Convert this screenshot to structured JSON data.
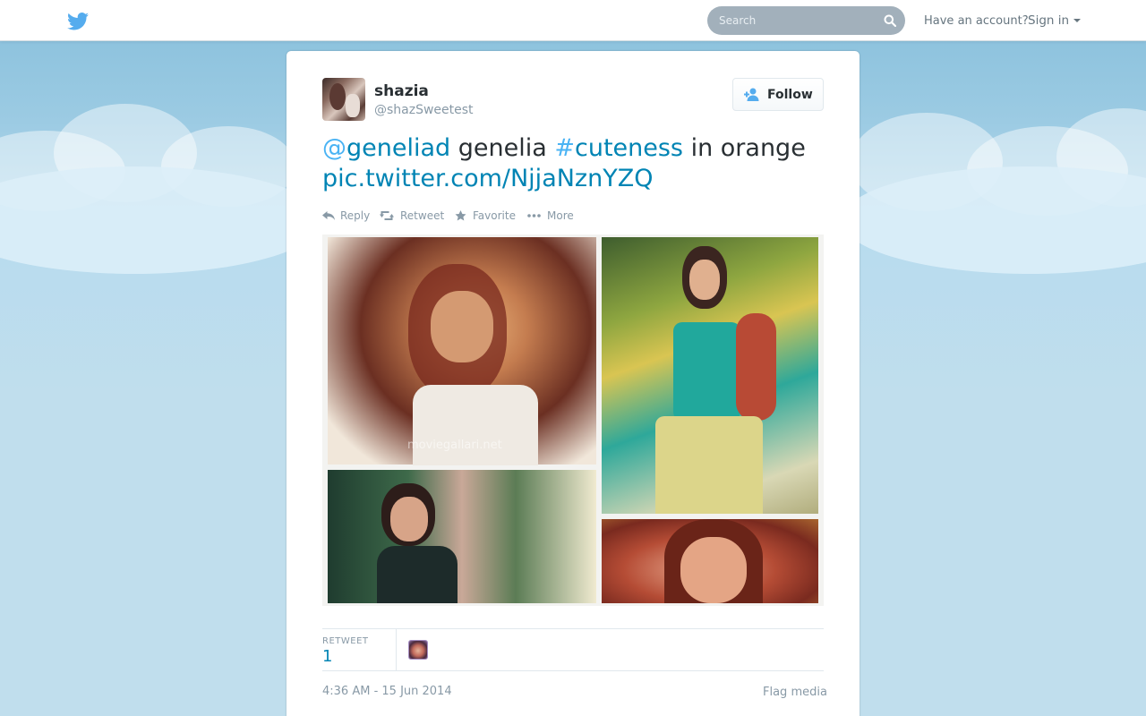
{
  "topbar": {
    "logo_icon": "twitter-bird-icon",
    "search_placeholder": "Search",
    "search_icon": "search-icon",
    "account_prompt": "Have an account?",
    "signin_label": "Sign in",
    "signin_icon": "caret-down-icon"
  },
  "tweet": {
    "user": {
      "fullname": "shazia",
      "screenname": "@shazSweetest",
      "follow_label": "Follow",
      "follow_icon": "add-user-icon"
    },
    "text": {
      "mention_at": "@",
      "mention": "geneliad",
      "word1": " genelia ",
      "hash_symbol": "#",
      "hashtag": "cuteness",
      "word2": " in orange ",
      "link": "pic.twitter.com/NjjaNznYZQ"
    },
    "actions": {
      "reply": "Reply",
      "retweet": "Retweet",
      "favorite": "Favorite",
      "more": "More"
    },
    "media": {
      "watermark": "moviegallari.net"
    },
    "stats": {
      "retweet_label": "RETWEET",
      "retweet_count": "1"
    },
    "timestamp": "4:36 AM - 15 Jun 2014",
    "flag_label": "Flag media"
  },
  "colors": {
    "link": "#0084b4",
    "link_light": "#4ab3f4",
    "text": "#292f33",
    "muted": "#8899a6",
    "background": "#c0deed"
  }
}
